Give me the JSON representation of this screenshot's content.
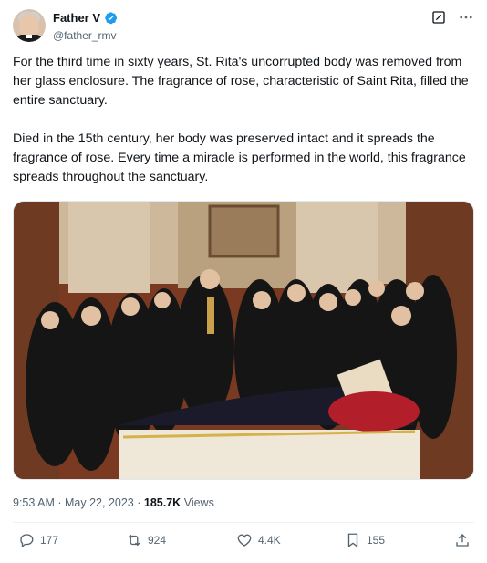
{
  "author": {
    "display_name": "Father V",
    "handle": "@father_rmv",
    "verified": true
  },
  "tweet": {
    "paragraphs": [
      "For the third time in sixty years, St. Rita's uncorrupted body was removed from her glass enclosure. The fragrance of rose, characteristic of Saint Rita, filled the entire sanctuary.",
      "Died in the 15th century, her body was preserved intact and it spreads the fragrance of rose. Every time a miracle is performed in the world, this fragrance spreads throughout the sanctuary."
    ]
  },
  "meta": {
    "time": "9:53 AM",
    "separator": "·",
    "date": "May 22, 2023",
    "views_count": "185.7K",
    "views_label": "Views"
  },
  "actions": {
    "replies": "177",
    "retweets": "924",
    "likes": "4.4K",
    "bookmarks": "155"
  },
  "colors": {
    "verified": "#1d9bf0",
    "secondary_text": "#536471",
    "primary_text": "#0f1419"
  },
  "icons": [
    "grok-icon",
    "more-icon",
    "reply-icon",
    "retweet-icon",
    "like-icon",
    "bookmark-icon",
    "share-icon",
    "verified-badge-icon"
  ]
}
